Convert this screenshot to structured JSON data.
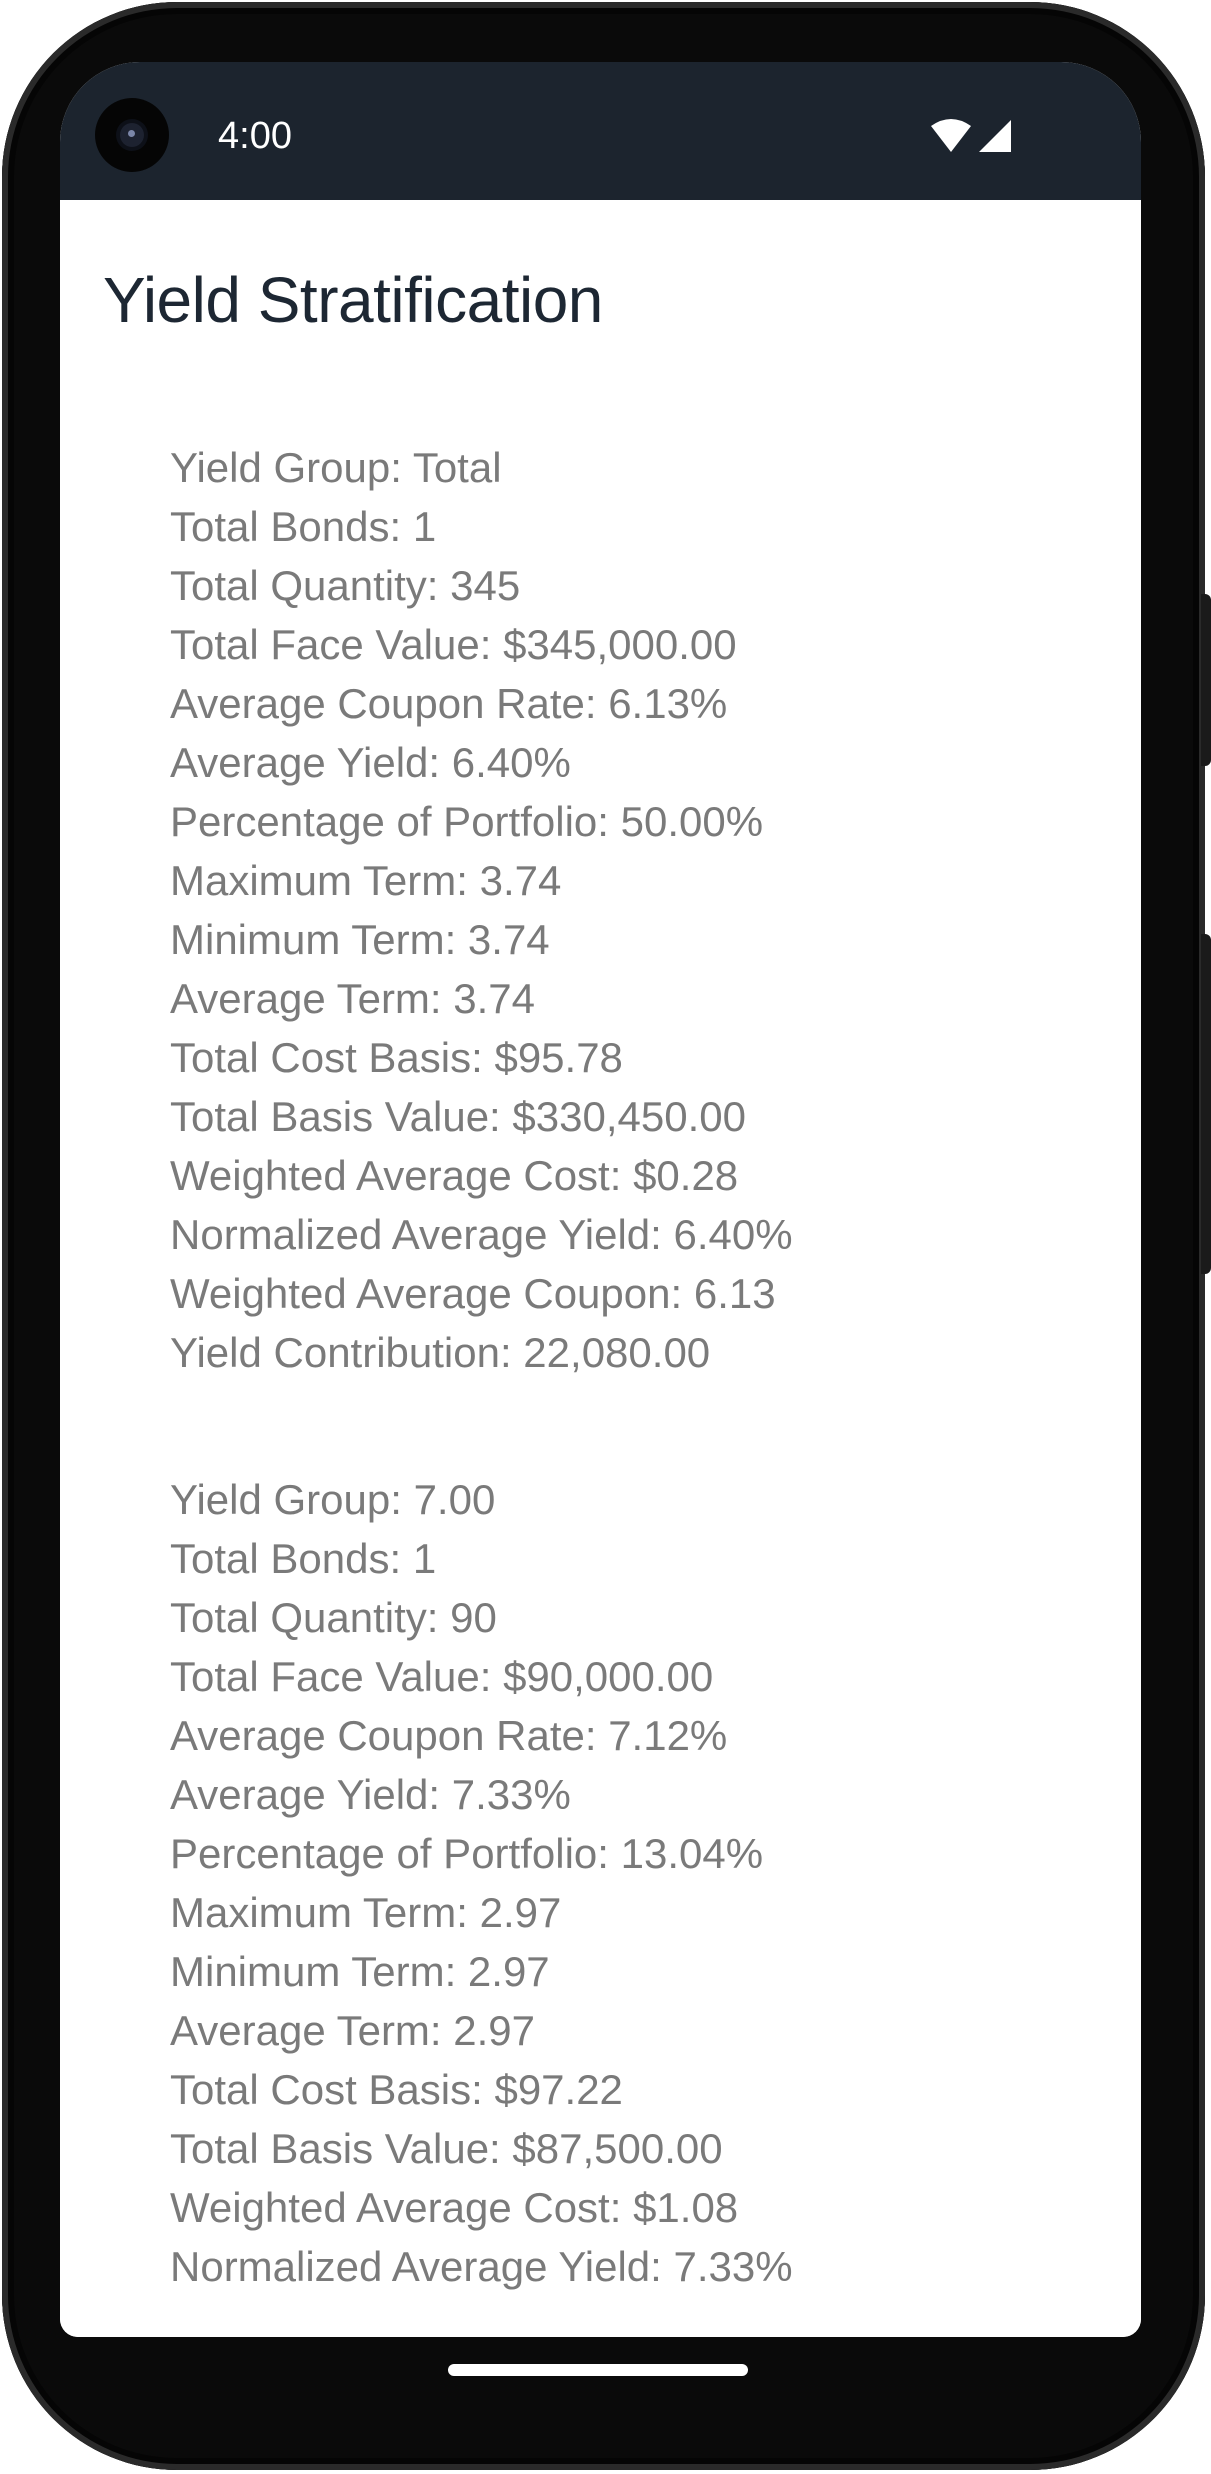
{
  "status_bar": {
    "time": "4:00",
    "icons": [
      "wifi-icon",
      "cellular-signal-icon"
    ]
  },
  "page": {
    "title": "Yield Stratification"
  },
  "groups": [
    {
      "lines": [
        "Yield Group: Total",
        "Total Bonds: 1",
        "Total Quantity: 345",
        "Total Face Value: $345,000.00",
        "Average Coupon Rate: 6.13%",
        "Average Yield: 6.40%",
        "Percentage of Portfolio: 50.00%",
        "Maximum Term: 3.74",
        "Minimum Term: 3.74",
        "Average Term: 3.74",
        "Total Cost Basis: $95.78",
        "Total Basis Value: $330,450.00",
        "Weighted Average Cost: $0.28",
        "Normalized Average Yield: 6.40%",
        "Weighted Average Coupon: 6.13",
        "Yield Contribution: 22,080.00"
      ]
    },
    {
      "lines": [
        "Yield Group: 7.00",
        "Total Bonds: 1",
        "Total Quantity: 90",
        "Total Face Value: $90,000.00",
        "Average Coupon Rate: 7.12%",
        "Average Yield: 7.33%",
        "Percentage of Portfolio: 13.04%",
        "Maximum Term: 2.97",
        "Minimum Term: 2.97",
        "Average Term: 2.97",
        "Total Cost Basis: $97.22",
        "Total Basis Value: $87,500.00",
        "Weighted Average Cost: $1.08",
        "Normalized Average Yield: 7.33%"
      ]
    }
  ],
  "colors": {
    "status_bar_bg": "#1c242e",
    "title_text": "#1d2733",
    "body_text": "#7a7a7a",
    "screen_bg": "#ffffff"
  }
}
